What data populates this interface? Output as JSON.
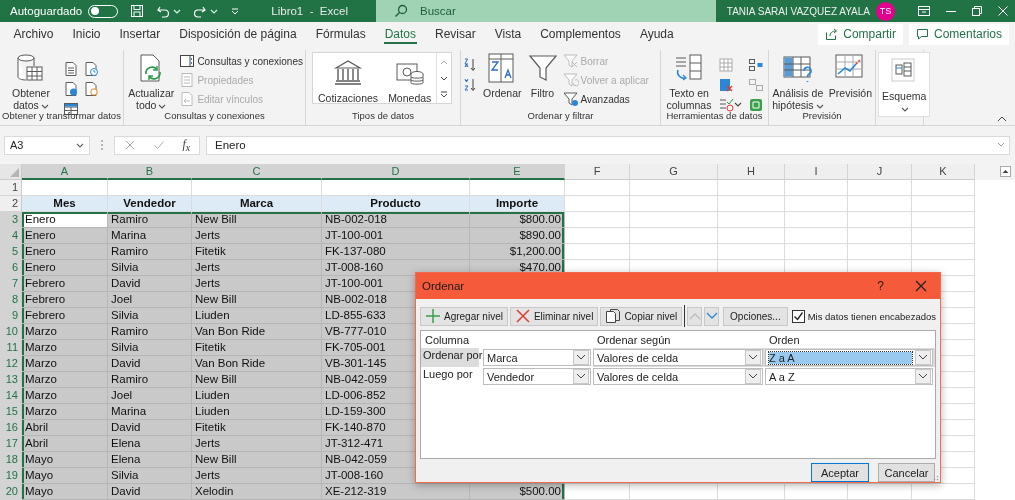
{
  "title_bar": {
    "autosave_label": "Autoguardado",
    "autosave_on": false,
    "title": "Libro1  -  Excel",
    "search_placeholder": "Buscar",
    "user_name": "TANIA SARAI VAZQUEZ AYALA",
    "avatar_initials": "TS"
  },
  "tabs": [
    {
      "label": "Archivo",
      "selected": false
    },
    {
      "label": "Inicio",
      "selected": false
    },
    {
      "label": "Insertar",
      "selected": false
    },
    {
      "label": "Disposición de página",
      "selected": false
    },
    {
      "label": "Fórmulas",
      "selected": false
    },
    {
      "label": "Datos",
      "selected": true
    },
    {
      "label": "Revisar",
      "selected": false
    },
    {
      "label": "Vista",
      "selected": false
    },
    {
      "label": "Complementos",
      "selected": false
    },
    {
      "label": "Ayuda",
      "selected": false
    }
  ],
  "share_button": "Compartir",
  "comments_button": "Comentarios",
  "ribbon": [
    {
      "label": "Obtener y transformar datos",
      "items": [
        {
          "kind": "large",
          "label": "Obtener datos",
          "dropdown": true
        }
      ]
    },
    {
      "label": "Consultas y conexiones",
      "items": [
        {
          "kind": "large",
          "label": "Actualizar todo",
          "dropdown": true
        },
        {
          "kind": "small",
          "label": "Consultas y conexiones",
          "disabled": false
        },
        {
          "kind": "small",
          "label": "Propiedades",
          "disabled": true
        },
        {
          "kind": "small",
          "label": "Editar vínculos",
          "disabled": true
        }
      ]
    },
    {
      "label": "Tipos de datos",
      "items": [
        {
          "kind": "gallery",
          "label": "Cotizaciones"
        },
        {
          "kind": "gallery",
          "label": "Monedas"
        }
      ]
    },
    {
      "label": "Ordenar y filtrar",
      "items": [
        {
          "kind": "large",
          "label": "Ordenar"
        },
        {
          "kind": "large",
          "label": "Filtro"
        },
        {
          "kind": "small",
          "label": "Borrar",
          "disabled": true
        },
        {
          "kind": "small",
          "label": "Volver a aplicar",
          "disabled": true
        },
        {
          "kind": "small",
          "label": "Avanzadas",
          "disabled": false
        }
      ]
    },
    {
      "label": "Herramientas de datos",
      "items": [
        {
          "kind": "large",
          "label": "Texto en columnas"
        }
      ]
    },
    {
      "label": "Previsión",
      "items": [
        {
          "kind": "large",
          "label": "Análisis de hipótesis",
          "dropdown": true
        },
        {
          "kind": "large",
          "label": "Previsión"
        }
      ]
    },
    {
      "items": [
        {
          "kind": "large",
          "label": "Esquema",
          "dropdown": true
        }
      ]
    }
  ],
  "formula_bar": {
    "name_box": "A3",
    "function_label": "f$_{x}$",
    "value": "Enero"
  },
  "sheet": {
    "columns": [
      {
        "label": "A",
        "selected": true
      },
      {
        "label": "B",
        "selected": true
      },
      {
        "label": "C",
        "selected": true
      },
      {
        "label": "D",
        "selected": true
      },
      {
        "label": "E",
        "selected": true
      },
      {
        "label": "F",
        "selected": false
      },
      {
        "label": "G",
        "selected": false
      },
      {
        "label": "H",
        "selected": false
      },
      {
        "label": "I",
        "selected": false
      },
      {
        "label": "J",
        "selected": false
      },
      {
        "label": "K",
        "selected": false
      }
    ],
    "rows": [
      {
        "number": "1",
        "kind": "blank",
        "selected": false
      },
      {
        "number": "2",
        "kind": "header",
        "selected": false,
        "cells": [
          "Mes",
          "Vendedor",
          "Marca",
          "Producto",
          "Importe"
        ]
      },
      {
        "number": "3",
        "kind": "data",
        "selected": true,
        "cells": [
          "Enero",
          "Ramiro",
          "New Bill",
          "NB-002-018",
          "$800.00"
        ]
      },
      {
        "number": "4",
        "kind": "data",
        "selected": true,
        "cells": [
          "Enero",
          "Marina",
          "Jerts",
          "JT-100-001",
          "$890.00"
        ]
      },
      {
        "number": "5",
        "kind": "data",
        "selected": true,
        "cells": [
          "Enero",
          "Ramiro",
          "Fitetik",
          "FK-137-080",
          "$1,200.00"
        ]
      },
      {
        "number": "6",
        "kind": "data",
        "selected": true,
        "cells": [
          "Enero",
          "Silvia",
          "Jerts",
          "JT-008-160",
          "$470.00"
        ]
      },
      {
        "number": "7",
        "kind": "data",
        "selected": true,
        "cells": [
          "Febrero",
          "David",
          "Jerts",
          "JT-100-001"
        ]
      },
      {
        "number": "8",
        "kind": "data",
        "selected": true,
        "cells": [
          "Febrero",
          "Joel",
          "New Bill",
          "NB-002-018"
        ]
      },
      {
        "number": "9",
        "kind": "data",
        "selected": true,
        "cells": [
          "Febrero",
          "Silvia",
          "Liuden",
          "LD-855-633"
        ]
      },
      {
        "number": "10",
        "kind": "data",
        "selected": true,
        "cells": [
          "Marzo",
          "Ramiro",
          "Van Bon Ride",
          "VB-777-010"
        ]
      },
      {
        "number": "11",
        "kind": "data",
        "selected": true,
        "cells": [
          "Marzo",
          "Silvia",
          "Fitetik",
          "FK-705-001"
        ]
      },
      {
        "number": "12",
        "kind": "data",
        "selected": true,
        "cells": [
          "Marzo",
          "David",
          "Van Bon Ride",
          "VB-301-145"
        ]
      },
      {
        "number": "13",
        "kind": "data",
        "selected": true,
        "cells": [
          "Marzo",
          "Ramiro",
          "New Bill",
          "NB-042-059"
        ]
      },
      {
        "number": "14",
        "kind": "data",
        "selected": true,
        "cells": [
          "Marzo",
          "Joel",
          "Liuden",
          "LD-006-852"
        ]
      },
      {
        "number": "15",
        "kind": "data",
        "selected": true,
        "cells": [
          "Marzo",
          "Marina",
          "Liuden",
          "LD-159-300"
        ]
      },
      {
        "number": "16",
        "kind": "data",
        "selected": true,
        "cells": [
          "Abril",
          "David",
          "Fitetik",
          "FK-140-870"
        ]
      },
      {
        "number": "17",
        "kind": "data",
        "selected": true,
        "cells": [
          "Abril",
          "Elena",
          "Jerts",
          "JT-312-471"
        ]
      },
      {
        "number": "18",
        "kind": "data",
        "selected": true,
        "cells": [
          "Mayo",
          "Elena",
          "New Bill",
          "NB-042-059"
        ]
      },
      {
        "number": "19",
        "kind": "data",
        "selected": true,
        "cells": [
          "Mayo",
          "Silvia",
          "Jerts",
          "JT-008-160"
        ]
      },
      {
        "number": "20",
        "kind": "data",
        "selected": true,
        "cells": [
          "Mayo",
          "David",
          "Xelodin",
          "XE-212-319",
          "$500.00"
        ]
      }
    ]
  },
  "dialog": {
    "title": "Ordenar",
    "help": "?",
    "tools": [
      {
        "kind": "add",
        "label": "Agregar nivel"
      },
      {
        "kind": "delete",
        "label": "Eliminar nivel"
      },
      {
        "kind": "copy",
        "label": "Copiar nivel"
      }
    ],
    "move_buttons": [
      {
        "kind": "up",
        "disabled": true
      },
      {
        "kind": "down",
        "disabled": false
      }
    ],
    "options_button": "Opciones...",
    "header_checkbox": {
      "label": "Mis datos tienen encabezados",
      "checked": true
    },
    "columns": [
      "Columna",
      "Ordenar según",
      "Orden"
    ],
    "levels": [
      {
        "label": "Ordenar por",
        "column": "Marca",
        "sort_on": "Valores de celda",
        "order": "Z a A",
        "selected": true
      },
      {
        "label": "Luego por",
        "column": "Vendedor",
        "sort_on": "Valores de celda",
        "order": "A a Z",
        "selected": false
      }
    ],
    "buttons": [
      {
        "label": "Aceptar",
        "default": true
      },
      {
        "label": "Cancelar",
        "default": false
      }
    ]
  }
}
